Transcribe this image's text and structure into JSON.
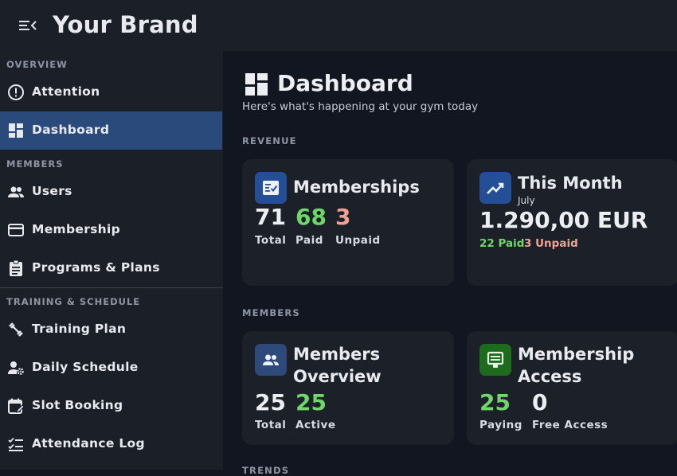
{
  "app": {
    "brand": "Your Brand"
  },
  "sidebar": {
    "sections": [
      {
        "title": "OVERVIEW"
      },
      {
        "title": "MEMBERS"
      },
      {
        "title": "TRAINING & SCHEDULE"
      }
    ],
    "items": [
      {
        "label": "Attention",
        "icon": "alert-circle-icon"
      },
      {
        "label": "Dashboard",
        "icon": "dashboard-icon",
        "active": true
      },
      {
        "label": "Users",
        "icon": "users-icon"
      },
      {
        "label": "Membership",
        "icon": "credit-card-icon"
      },
      {
        "label": "Programs & Plans",
        "icon": "clipboard-icon"
      },
      {
        "label": "Training Plan",
        "icon": "dumbbell-icon"
      },
      {
        "label": "Daily Schedule",
        "icon": "person-gear-icon"
      },
      {
        "label": "Slot Booking",
        "icon": "calendar-edit-icon"
      },
      {
        "label": "Attendance Log",
        "icon": "checklist-icon"
      }
    ]
  },
  "page": {
    "title": "Dashboard",
    "subtitle": "Here's what's happening at your gym today"
  },
  "revenue": {
    "section_title": "REVENUE",
    "memberships": {
      "title": "Memberships",
      "total_value": "71",
      "total_label": "Total",
      "paid_value": "68",
      "paid_label": "Paid",
      "unpaid_value": "3",
      "unpaid_label": "Unpaid"
    },
    "this_month": {
      "title": "This Month",
      "month": "July",
      "amount": "1.290,00 EUR",
      "paid": "22 Paid",
      "unpaid": "3 Unpaid"
    }
  },
  "members": {
    "section_title": "MEMBERS",
    "overview": {
      "title_line1": "Members",
      "title_line2": "Overview",
      "total_value": "25",
      "total_label": "Total",
      "active_value": "25",
      "active_label": "Active"
    },
    "access": {
      "title_line1": "Membership",
      "title_line2": "Access",
      "paying_value": "25",
      "paying_label": "Paying",
      "free_value": "0",
      "free_label": "Free Access"
    }
  },
  "trends": {
    "section_title": "TRENDS"
  },
  "colors": {
    "accent": "#2b4a7c",
    "positive": "#6fd66a",
    "negative": "#f2a094",
    "background": "#121620",
    "panel": "#1b1f27",
    "card": "#1c2028"
  }
}
